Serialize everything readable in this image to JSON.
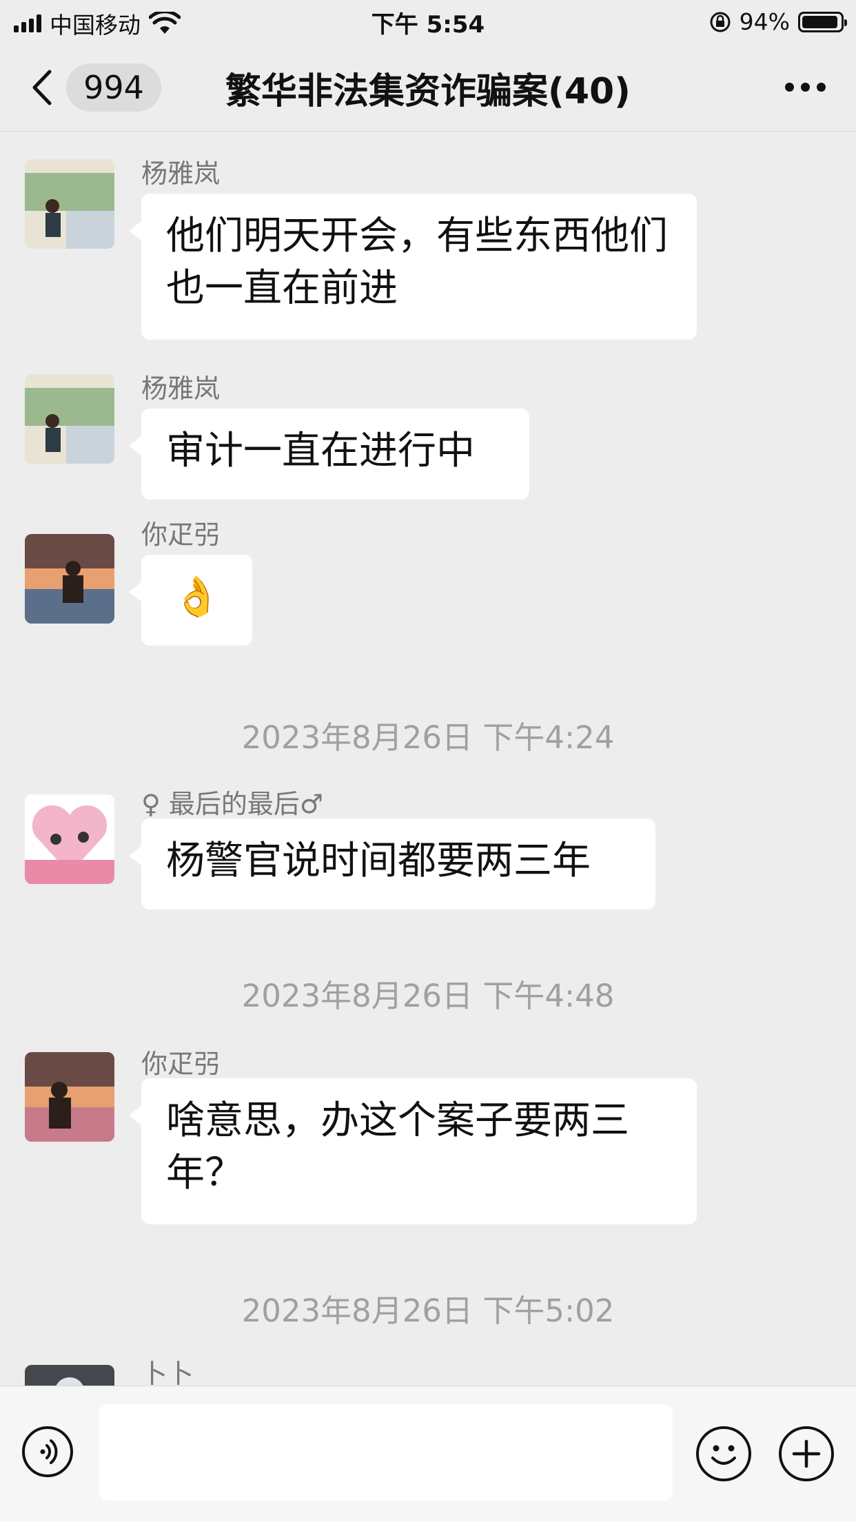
{
  "status_bar": {
    "carrier": "中国移动",
    "time": "下午 5:54",
    "battery_percent": "94%",
    "battery_level": 0.94
  },
  "nav": {
    "unread_count": "994",
    "title": "繁华非法集资诈骗案(40)"
  },
  "messages": [
    {
      "sender": "杨雅岚",
      "text": "他们明天开会，有些东西他们也一直在前进"
    },
    {
      "sender": "杨雅岚",
      "text": "审计一直在进行中"
    },
    {
      "sender": "你疋弜",
      "text": "👌"
    },
    {
      "timestamp": "2023年8月26日 下午4:24"
    },
    {
      "sender": "♀ 最后的最后♂",
      "text": "杨警官说时间都要两三年"
    },
    {
      "timestamp": "2023年8月26日 下午4:48"
    },
    {
      "sender": "你疋弜",
      "text": "啥意思，办这个案子要两三年？"
    },
    {
      "timestamp": "2023年8月26日 下午5:02"
    },
    {
      "sender": "卜卜"
    }
  ],
  "icons": {
    "back": "chevron-left-icon",
    "more": "more-dots-icon",
    "voice": "voice-icon",
    "emoji": "emoji-icon",
    "plus": "plus-icon"
  }
}
